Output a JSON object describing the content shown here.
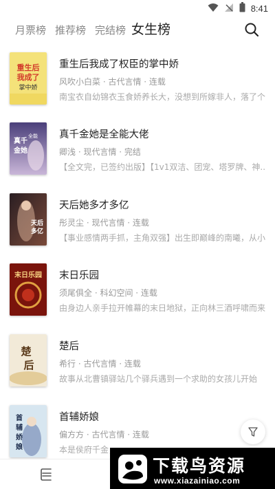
{
  "status_bar": {
    "time": "8:41"
  },
  "tabs": [
    {
      "label": "月票榜",
      "active": false
    },
    {
      "label": "推荐榜",
      "active": false
    },
    {
      "label": "完结榜",
      "active": false
    },
    {
      "label": "女生榜",
      "active": true
    }
  ],
  "books": [
    {
      "title": "重生后我成了权臣的掌中娇",
      "meta": "风吹小白菜 · 古代言情 · 连载",
      "desc": "南宝衣自幼锦衣玉食娇养长大，没想到所嫁非人，落了个..."
    },
    {
      "title": "真千金她是全能大佬",
      "meta": "卿浅 · 现代言情 · 完结",
      "desc": "【全文完，已签约出版】【1v1双洁、团宠、塔罗牌、神..."
    },
    {
      "title": "天后她多才多亿",
      "meta": "彤灵尘 · 现代言情 · 连载",
      "desc": "【事业感情两手抓，主角双强】出生即巅峰的南曦，从小..."
    },
    {
      "title": "末日乐园",
      "meta": "须尾俱全 · 科幻空间 · 连载",
      "desc": "由身边人亲手拉开帷幕的末日地狱，正向林三酒呼啸而来。"
    },
    {
      "title": "楚后",
      "meta": "希行 · 古代言情 · 连载",
      "desc": "故事从北曹镇驿站几个驿兵遇到一个求助的女孩儿开始"
    },
    {
      "title": "首辅娇娘",
      "meta": "偏方方 · 古代言情 · 连载",
      "desc": "本是侯府千金，"
    }
  ],
  "covers": [
    {
      "text": "重生后我成了权臣的掌中娇",
      "bg": "#f4e27a"
    },
    {
      "text": "真千金她是全能大佬",
      "bg": "#5a4a8a"
    },
    {
      "text": "天后她多才多亿",
      "bg": "#3a2a2a"
    },
    {
      "text": "末日乐园",
      "bg": "#8a1a10"
    },
    {
      "text": "楚后",
      "bg": "#f2ead8"
    },
    {
      "text": "首辅娇娘",
      "bg": "#d7e6f0"
    }
  ],
  "watermark": {
    "text": "下载鸟资源",
    "url": "www.xiazainiao.com"
  },
  "icons": {
    "search": "search-icon",
    "filter": "filter-icon",
    "bookshelf": "bookshelf-icon",
    "wifi": "wifi-icon",
    "signal": "signal-icon",
    "battery": "battery-icon"
  },
  "colors": {
    "accent": "#222222",
    "muted": "#999999"
  }
}
